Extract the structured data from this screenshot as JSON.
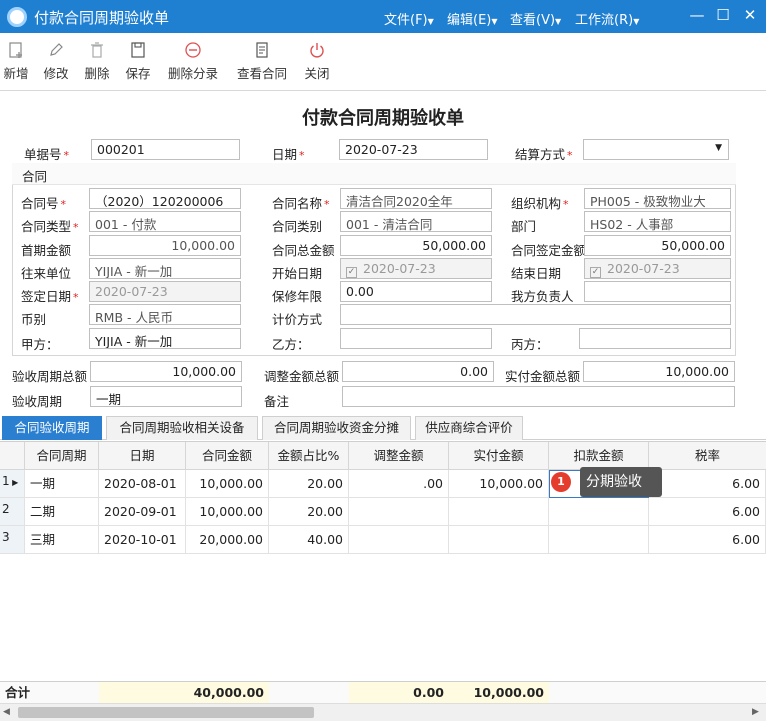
{
  "window": {
    "title": "付款合同周期验收单",
    "menus": [
      "文件(F)",
      "编辑(E)",
      "查看(V)",
      "工作流(R)"
    ]
  },
  "toolbar": {
    "buttons": [
      "新增",
      "修改",
      "删除",
      "保存",
      "删除分录",
      "查看合同",
      "关闭"
    ]
  },
  "form": {
    "title": "付款合同周期验收单",
    "doc_no_label": "单据号",
    "doc_no": "000201",
    "date_label": "日期",
    "date": "2020-07-23",
    "settle_label": "结算方式",
    "settle": "",
    "contract_group": "合同",
    "contract_no_label": "合同号",
    "contract_no": "（2020）120200006",
    "contract_name_label": "合同名称",
    "contract_name": "清洁合同2020全年",
    "org_label": "组织机构",
    "org": "PH005 - 极致物业大",
    "contract_type_label": "合同类型",
    "contract_type": "001 - 付款",
    "contract_cat_label": "合同类别",
    "contract_cat": "001 - 清洁合同",
    "dept_label": "部门",
    "dept": "HS02 - 人事部",
    "first_amt_label": "首期金额",
    "first_amt": "10,000.00",
    "total_amt_label": "合同总金额",
    "total_amt": "50,000.00",
    "signed_amt_label": "合同签定金额",
    "signed_amt": "50,000.00",
    "partner_label": "往来单位",
    "partner": "YIJIA - 新一加",
    "start_label": "开始日期",
    "start": "2020-07-23",
    "end_label": "结束日期",
    "end": "2020-07-23",
    "sign_date_label": "签定日期",
    "sign_date": "2020-07-23",
    "warranty_label": "保修年限",
    "warranty": "0.00",
    "owner_label": "我方负责人",
    "owner": "",
    "currency_label": "币别",
    "currency": "RMB - 人民币",
    "pricing_label": "计价方式",
    "pricing": "",
    "party_a_label": "甲方：",
    "party_a": "YIJIA - 新一加",
    "party_b_label": "乙方：",
    "party_b": "",
    "party_c_label": "丙方：",
    "party_c": "",
    "accept_total_label": "验收周期总额",
    "accept_total": "10,000.00",
    "adjust_total_label": "调整金额总额",
    "adjust_total": "0.00",
    "paid_total_label": "实付金额总额",
    "paid_total": "10,000.00",
    "cycle_label": "验收周期",
    "cycle": "一期",
    "remark_label": "备注",
    "remark": ""
  },
  "tabs": [
    "合同验收周期",
    "合同周期验收相关设备",
    "合同周期验收资金分摊",
    "供应商综合评价"
  ],
  "grid": {
    "headers": [
      "合同周期",
      "日期",
      "合同金额",
      "金额占比%",
      "调整金额",
      "实付金额",
      "扣款金额",
      "税率"
    ],
    "rows": [
      {
        "n": "1",
        "c": [
          "一期",
          "2020-08-01",
          "10,000.00",
          "20.00",
          ".00",
          "10,000.00",
          "",
          "6.00"
        ]
      },
      {
        "n": "2",
        "c": [
          "二期",
          "2020-09-01",
          "10,000.00",
          "20.00",
          "",
          "",
          "",
          "6.00"
        ]
      },
      {
        "n": "3",
        "c": [
          "三期",
          "2020-10-01",
          "20,000.00",
          "40.00",
          "",
          "",
          "",
          "6.00"
        ]
      }
    ],
    "total_label": "合计",
    "total_amt": "40,000.00",
    "total_adjust": "0.00",
    "total_paid": "10,000.00"
  },
  "tooltip": {
    "badge": "1",
    "text": "分期验收"
  },
  "colors": {
    "titlebar": "#1f7fd1",
    "tab_active": "#2b7fd0",
    "required": "#e02020"
  }
}
